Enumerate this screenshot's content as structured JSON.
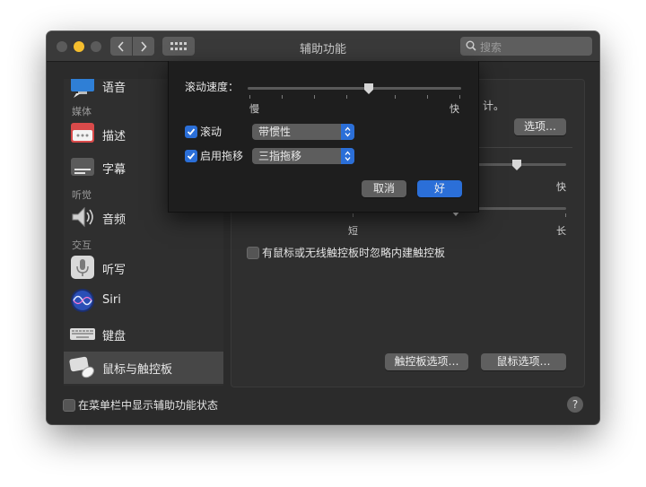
{
  "window": {
    "title": "辅助功能"
  },
  "search": {
    "placeholder": "搜索"
  },
  "sidebar": {
    "items": [
      {
        "label": "语音",
        "icon": "speech-icon"
      },
      {
        "label": "描述",
        "icon": "descriptions-icon"
      },
      {
        "label": "字幕",
        "icon": "captions-icon"
      },
      {
        "label": "音频",
        "icon": "audio-icon"
      },
      {
        "label": "听写",
        "icon": "dictation-icon"
      },
      {
        "label": "Siri",
        "icon": "siri-icon"
      },
      {
        "label": "键盘",
        "icon": "keyboard-icon"
      },
      {
        "label": "鼠标与触控板",
        "icon": "mouse-trackpad-icon",
        "selected": true
      }
    ],
    "headers": {
      "media": "媒体",
      "hearing": "听觉",
      "interacting": "交互"
    }
  },
  "panel": {
    "partial_text": "计。",
    "options_button": "选项…",
    "speed_fast_label": "快",
    "delay_short_label": "短",
    "delay_long_label": "长",
    "ignore_trackpad_label": "有鼠标或无线触控板时忽略内建触控板",
    "ignore_trackpad_checked": false,
    "trackpad_options_button": "触控板选项…",
    "mouse_options_button": "鼠标选项…"
  },
  "sheet": {
    "scroll_speed_label": "滚动速度：",
    "slow_label": "慢",
    "fast_label": "快",
    "scroll_speed_value": 0.6,
    "scrolling_label": "滚动",
    "scrolling_checked": true,
    "scrolling_value": "带惯性",
    "drag_label": "启用拖移",
    "drag_checked": true,
    "drag_value": "三指拖移",
    "cancel_button": "取消",
    "ok_button": "好"
  },
  "footer": {
    "show_in_menubar_label": "在菜单栏中显示辅助功能状态",
    "show_in_menubar_checked": false,
    "help_label": "?"
  },
  "colors": {
    "accent": "#2b6fd8",
    "window_bg": "#2b2b2b",
    "minimize": "#f5be2e"
  }
}
